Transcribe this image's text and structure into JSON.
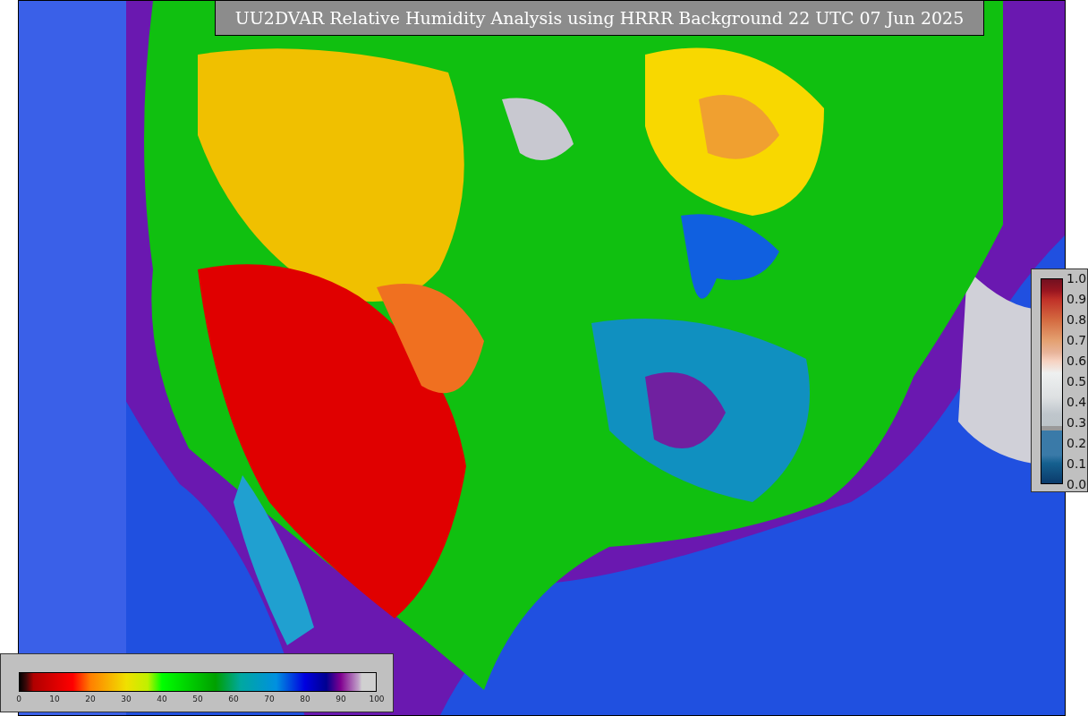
{
  "title": "UU2DVAR Relative Humidity Analysis using HRRR Background 22 UTC 07 Jun 2025",
  "humidity_colorbar": {
    "ticks": [
      "0",
      "10",
      "20",
      "30",
      "40",
      "50",
      "60",
      "70",
      "80",
      "90",
      "100"
    ]
  },
  "observation_colorbar": {
    "ticks": [
      "1.0",
      "0.9",
      "0.8",
      "0.7",
      "0.6",
      "0.5",
      "0.4",
      "0.3",
      "0.2",
      "0.1",
      "0.0"
    ]
  }
}
